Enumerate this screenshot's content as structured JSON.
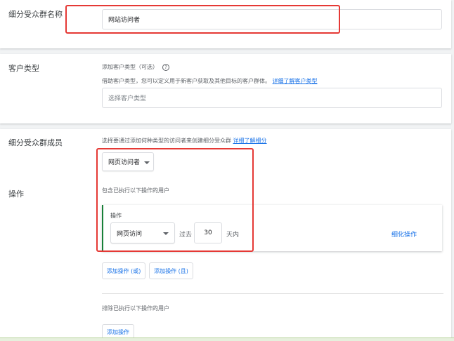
{
  "name_section": {
    "label": "细分受众群名称",
    "input_value": "网站访问者"
  },
  "customer_type_section": {
    "label": "客户类型",
    "title": "添加客户类型（可选）",
    "help_icon": "?",
    "description": "借助客户类型，您可以定义用于新客户获取及其他目标的客户群体。",
    "learn_more_link": "详细了解客户类型",
    "select_placeholder": "选择客户类型"
  },
  "members_section": {
    "label": "细分受众群成员",
    "description": "选择要通过添加何种类型的访问者来创建细分受众群",
    "learn_more_link": "详细了解细分",
    "visitor_type_dropdown": "网页访问者"
  },
  "actions_section": {
    "label": "操作",
    "include_heading": "包含已执行以下操作的用户",
    "action_card": {
      "title": "操作",
      "action_dropdown": "网页访问",
      "past_label": "过去",
      "days_value": "30",
      "days_unit": "天内",
      "refine_link": "细化操作"
    },
    "add_or_button": "添加操作 (或)",
    "add_and_button": "添加操作 (且)",
    "exclude_heading": "排除已执行以下操作的用户",
    "exclude_add_button": "添加操作"
  },
  "colors": {
    "highlight": "#e53935",
    "link": "#1a73e8",
    "action_accent": "#188038"
  }
}
